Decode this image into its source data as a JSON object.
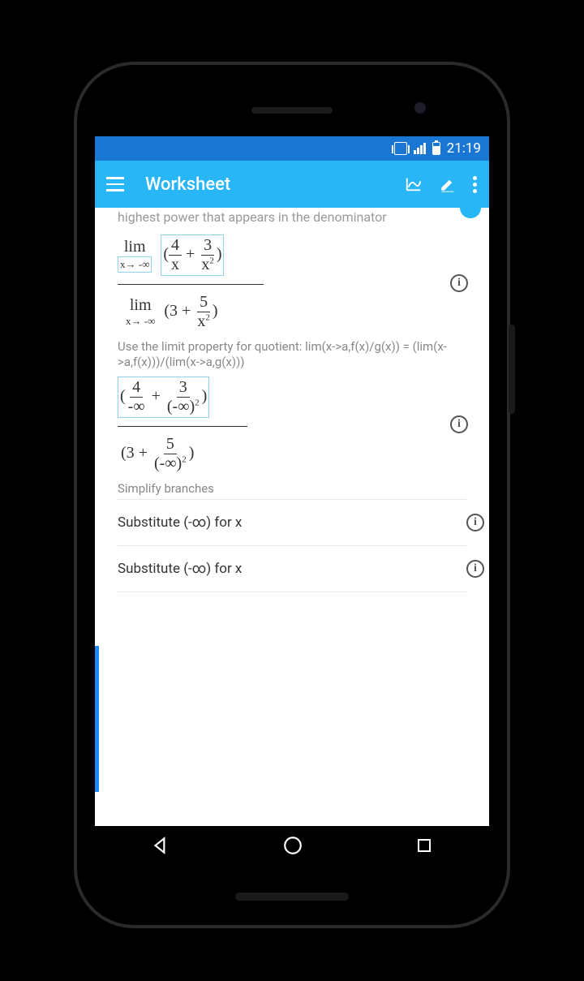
{
  "status": {
    "time": "21:19"
  },
  "toolbar": {
    "title": "Worksheet"
  },
  "content": {
    "cutoff_text": "highest power that appears in the denominator",
    "hint1": "Use the limit property for quotient:  lim(x->a,f(x)/g(x)) = (lim(x->a,f(x)))/(lim(x->a,g(x)))",
    "simplify": "Simplify  branches",
    "sub1": "Substitute (-∞)  for  x",
    "sub2": "Substitute (-∞)  for  x",
    "expr1": {
      "lim": "lim",
      "approach": "x→ -∞",
      "n1": "4",
      "d1": "x",
      "n2": "3",
      "d2b": "x",
      "d2e": "2"
    },
    "expr2": {
      "lim": "lim",
      "approach": "x→ -∞",
      "c": "3",
      "n": "5",
      "db": "x",
      "de": "2"
    },
    "expr3": {
      "n1": "4",
      "d1": "-∞",
      "n2": "3",
      "d2b": "(-∞)",
      "d2e": "2",
      "c": "3",
      "n3": "5",
      "d3b": "(-∞)",
      "d3e": "2"
    }
  }
}
